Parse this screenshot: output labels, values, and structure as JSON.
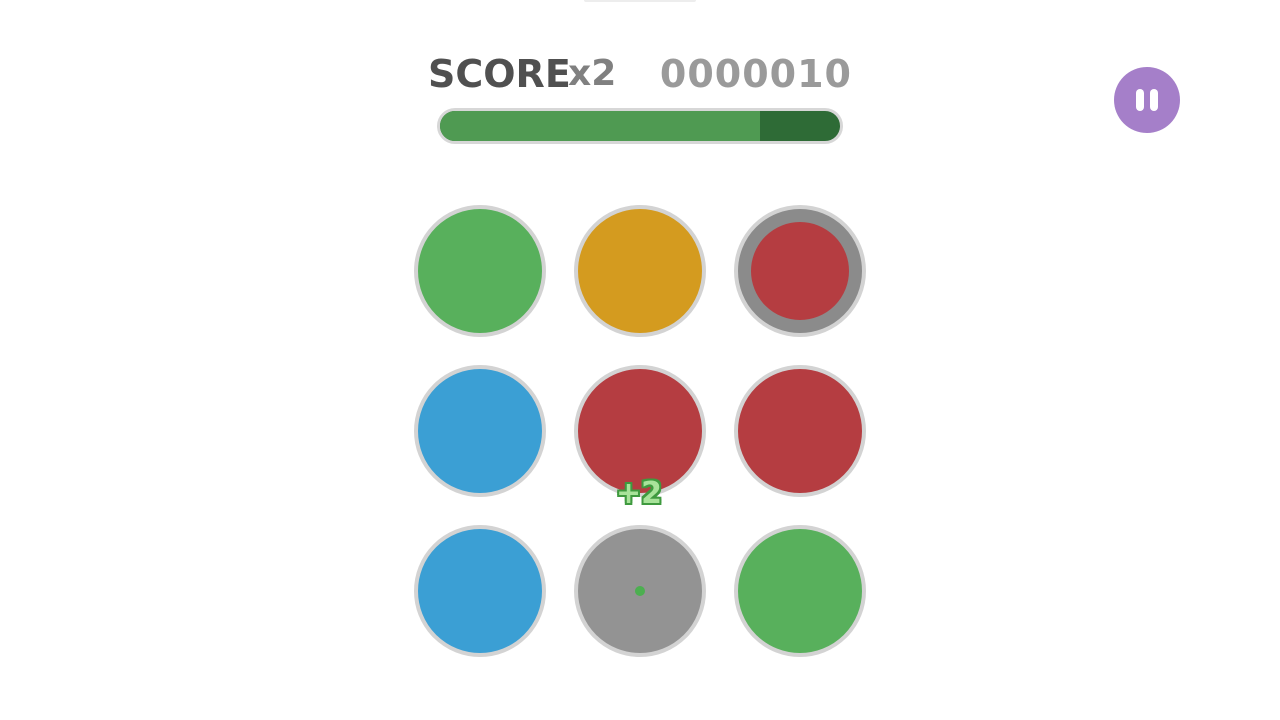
{
  "hud": {
    "score_label": "SCORE",
    "multiplier": "x2",
    "score_value": "0000010",
    "timer_fraction": 0.8,
    "timer_fill_color": "#4f9a52",
    "timer_track_color": "#2e6b36"
  },
  "pause_button": {
    "icon": "pause-icon",
    "color": "#a57fc9"
  },
  "grid": {
    "rows": 3,
    "cols": 3,
    "cells": [
      {
        "color": "#58b05c",
        "state": "normal"
      },
      {
        "color": "#d49b1f",
        "state": "normal"
      },
      {
        "color": "#b53d41",
        "state": "selected"
      },
      {
        "color": "#3b9fd4",
        "state": "normal"
      },
      {
        "color": "#b53d41",
        "state": "normal"
      },
      {
        "color": "#b53d41",
        "state": "normal"
      },
      {
        "color": "#3b9fd4",
        "state": "normal"
      },
      {
        "color": "#939393",
        "state": "empty",
        "dot_color": "#4caf50"
      },
      {
        "color": "#58b05c",
        "state": "normal"
      }
    ]
  },
  "floating_points": {
    "text": "+2",
    "color": "#a8e39a"
  }
}
